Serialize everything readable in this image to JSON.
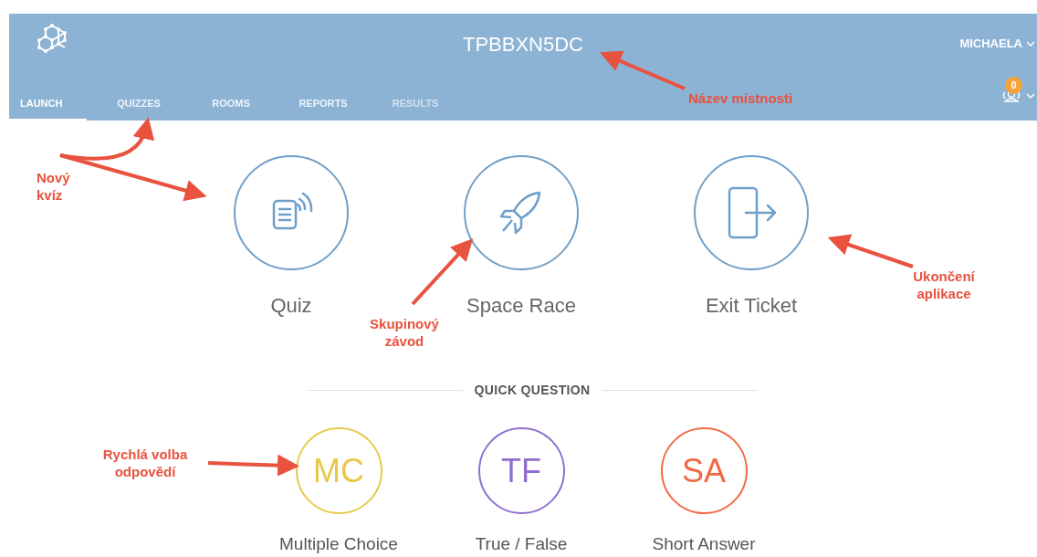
{
  "header": {
    "room_name": "TPBBXN5DC",
    "user": "MICHAELA",
    "students_badge": "0"
  },
  "tabs": [
    {
      "label": "LAUNCH",
      "selected": true,
      "disabled": false
    },
    {
      "label": "QUIZZES",
      "selected": false,
      "disabled": false
    },
    {
      "label": "ROOMS",
      "selected": false,
      "disabled": false
    },
    {
      "label": "REPORTS",
      "selected": false,
      "disabled": false
    },
    {
      "label": "RESULTS",
      "selected": false,
      "disabled": true
    }
  ],
  "launch_options": [
    {
      "kind": "quiz",
      "label": "Quiz"
    },
    {
      "kind": "rocket",
      "label": "Space Race"
    },
    {
      "kind": "exit",
      "label": "Exit Ticket"
    }
  ],
  "quick_question": {
    "title": "QUICK QUESTION",
    "options": [
      {
        "abbr": "MC",
        "label": "Multiple Choice",
        "color": "#e8c84a"
      },
      {
        "abbr": "TF",
        "label": "True / False",
        "color": "#8e6fd0"
      },
      {
        "abbr": "SA",
        "label": "Short Answer",
        "color": "#f26a45"
      }
    ]
  },
  "annotations": [
    "Název místnosti",
    "Nový kvíz",
    "Skupinový závod",
    "Ukončení aplikace",
    "Rychlá volba odpovědí"
  ]
}
